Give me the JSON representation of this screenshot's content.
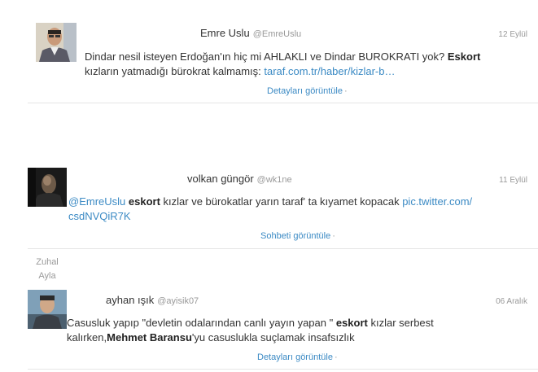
{
  "tweets": [
    {
      "name": "Emre Uslu",
      "handle": "@EmreUslu",
      "date": "12 Eylül",
      "line1_a": "Dindar nesil isteyen Erdoğan'ın hiç mi AHLAKLI ve Dindar BUROKRATI yok? ",
      "line1_b": "Eskort",
      "line2_a": "kızların yatmadığı bürokrat kalmamış: ",
      "line2_link": "taraf.com.tr/haber/kizlar-b…",
      "action": "Detayları görüntüle",
      "action_dot": "·"
    },
    {
      "name": "volkan güngör",
      "handle": "@wk1ne",
      "date": "11 Eylül",
      "mention": "@EmreUslu",
      "bold": "eskort",
      "text_a": " kızlar ve bürokatlar yarın taraf' ta kıyamet kopacak ",
      "link_a": "pic.twitter.com/",
      "link_b": "csdNVQiR7K",
      "action": "Sohbeti görüntüle",
      "action_dot": "·"
    },
    {
      "name": "ayhan ışık",
      "handle": "@ayisik07",
      "date": "06 Aralık",
      "line1_a": "Casusluk yapıp \"devletin odalarından canlı yayın yapan \" ",
      "line1_bold": "eskort",
      "line1_b": " kızlar serbest",
      "line2_a": "kalırken,",
      "line2_bold": "Mehmet Baransu",
      "line2_b": "'yu casuslukla suçlamak insafsızlık",
      "action": "Detayları görüntüle",
      "action_dot": "·"
    }
  ],
  "sidebar_user": {
    "first": "Zuhal",
    "last": "Ayla"
  }
}
